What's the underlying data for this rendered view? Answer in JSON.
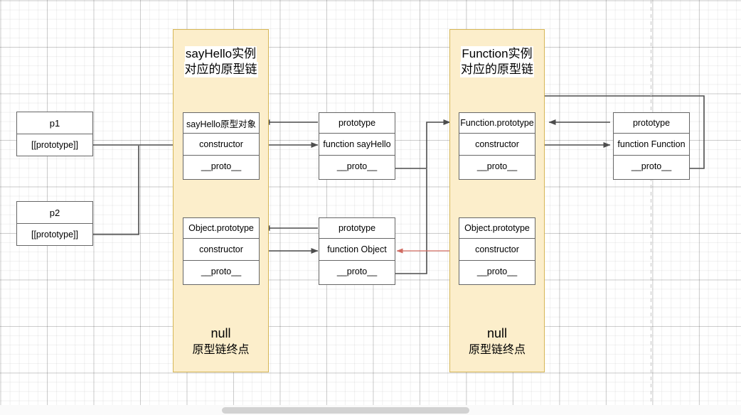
{
  "diagram": {
    "title_left": "sayHello实例\n对应的原型链",
    "title_right": "Function实例\n对应的原型链"
  },
  "groups": [
    {
      "name": "sayHello-chain-group",
      "title_line1": "sayHello实例",
      "title_line2": "对应的原型链",
      "null_line1": "null",
      "null_line2": "原型链终点"
    },
    {
      "name": "function-chain-group",
      "title_line1": "Function实例",
      "title_line2": "对应的原型链",
      "null_line1": "null",
      "null_line2": "原型链终点"
    }
  ],
  "boxes": {
    "p1": {
      "row1": "p1",
      "row2": "[[prototype]]"
    },
    "p2": {
      "row1": "p2",
      "row2": "[[prototype]]"
    },
    "sayhello_proto": {
      "row1": "sayHello原型对象",
      "row2": "constructor",
      "row3": "__proto__"
    },
    "function_sayhello": {
      "row1": "prototype",
      "row2": "function sayHello",
      "row3": "__proto__"
    },
    "object_prototype_left": {
      "row1": "Object.prototype",
      "row2": "constructor",
      "row3": "__proto__"
    },
    "function_object": {
      "row1": "prototype",
      "row2": "function Object",
      "row3": "__proto__"
    },
    "function_prototype": {
      "row1": "Function.prototype",
      "row2": "constructor",
      "row3": "__proto__"
    },
    "function_function": {
      "row1": "prototype",
      "row2": "function Function",
      "row3": "__proto__"
    },
    "object_prototype_right": {
      "row1": "Object.prototype",
      "row2": "constructor",
      "row3": "__proto__"
    }
  },
  "colors": {
    "group_fill": "#fceecb",
    "group_border": "#d6b656",
    "box_border": "#666666",
    "box_fill": "#ffffff",
    "connector": "#4d4d4d",
    "connector_red": "#d06a61",
    "grid_minor": "#f0f0f0",
    "grid_major": "#d6d6d6",
    "guide_dashed": "#cccccc"
  }
}
